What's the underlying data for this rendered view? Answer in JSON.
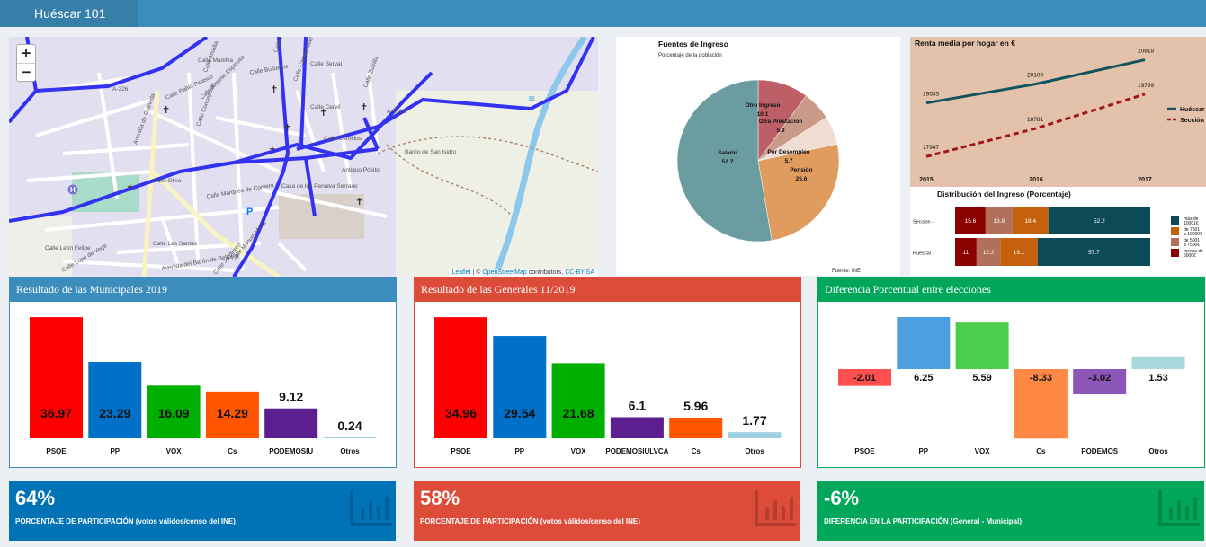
{
  "header": {
    "title": "Huéscar 101"
  },
  "map": {
    "zoom_in": "+",
    "zoom_out": "−",
    "attribution": {
      "leaflet": "Leaflet",
      "sep": " | © ",
      "osm": "OpenStreetMap",
      "contrib": " contributors, ",
      "license": "CC-BY-SA"
    },
    "road_labels": [
      "Calle Manilva",
      "Calle Bulluelos",
      "Calle Serval",
      "Calle Mayor",
      "Calle Pablo Picasso",
      "Calle Antonio Espinosa",
      "Calle Ahadia",
      "Calle Cervil",
      "Calle Campanillas",
      "Calle Zorrilla",
      "A-4302",
      "A-326",
      "Avenida de Granada",
      "Calle Concepción",
      "Calle Cerbillos",
      "Barrio de San Isidro",
      "Antiguo Pósito",
      "Casa de los Penalva Serrano",
      "Calle Oliva",
      "Calle Marqués de Corvera",
      "Calle Las Santas",
      "Calle León Felipe",
      "Calle Lope de Vega",
      "Avenida del Barón de Bellpuig",
      "Calle Manuel Mena",
      "Calle Jardinero"
    ],
    "colors": {
      "roads_main": "#3232f0",
      "river": "#8cc8ec",
      "land": "#e2dff0"
    }
  },
  "pie": {
    "title": "Fuentes de Ingreso",
    "subtitle": "Porcentaje de la población",
    "source": "Fuente: INE",
    "slices": [
      {
        "label": "Otro Ingreso",
        "value": 10.1,
        "color": "#bd5f66"
      },
      {
        "label": "Otra Prestación",
        "value": 5.9,
        "color": "#ca9a88"
      },
      {
        "label": "Por Desempleo",
        "value": 5.7,
        "color": "#efddd2"
      },
      {
        "label": "Pensión",
        "value": 25.6,
        "color": "#e09b5f"
      },
      {
        "label": "Salario",
        "value": 52.7,
        "color": "#6b9ca0"
      }
    ]
  },
  "renta": {
    "title": "Renta media por hogar en €",
    "years": [
      "2015",
      "2016",
      "2017"
    ],
    "series": [
      {
        "name": "Huéscar",
        "values": [
          19535,
          20100,
          20818
        ],
        "color": "#11535e"
      },
      {
        "name": "Sección",
        "values": [
          17947,
          18781,
          19799
        ],
        "color": "#a01515"
      }
    ]
  },
  "distribucion": {
    "title": "Distribución del Ingreso (Porcentaje)",
    "rows": [
      {
        "label": "Seccion",
        "values": [
          15.6,
          13.8,
          18.4,
          52.2
        ]
      },
      {
        "label": "Huescar",
        "values": [
          11,
          12.2,
          19.1,
          57.7
        ]
      }
    ],
    "segment_colors": [
      "#8b0000",
      "#b0705a",
      "#c5600d",
      "#0c4a58"
    ],
    "legend": [
      {
        "lines": [
          "más de",
          "10001€"
        ],
        "color": "#0c4a58"
      },
      {
        "lines": [
          "de 7501",
          "a 10000€"
        ],
        "color": "#c5600d"
      },
      {
        "lines": [
          "de 5001",
          "a 7500€"
        ],
        "color": "#b0705a"
      },
      {
        "lines": [
          "menos de",
          "5000€"
        ],
        "color": "#8b0000"
      }
    ]
  },
  "municipales": {
    "title": "Resultado de las Municipales 2019",
    "chart_data": {
      "type": "bar",
      "categories": [
        "PSOE",
        "PP",
        "VOX",
        "Cs",
        "PODEMOSIU",
        "Otros"
      ],
      "values": [
        36.97,
        23.29,
        16.09,
        14.29,
        9.12,
        0.24
      ],
      "labels": [
        "36.97",
        "23.29",
        "16.09",
        "14.29",
        "9.12",
        "0.24"
      ],
      "colors": [
        "#ff0000",
        "#0070c8",
        "#00b000",
        "#ff5500",
        "#5b1f8f",
        "#9dd0e0"
      ],
      "ylim": [
        0,
        37
      ]
    }
  },
  "generales": {
    "title": "Resultado de las Generales 11/2019",
    "chart_data": {
      "type": "bar",
      "categories": [
        "PSOE",
        "PP",
        "VOX",
        "PODEMOSIULVCA",
        "Cs",
        "Otros"
      ],
      "values": [
        34.96,
        29.54,
        21.68,
        6.1,
        5.96,
        1.77
      ],
      "labels": [
        "34.96",
        "29.54",
        "21.68",
        "6.1",
        "5.96",
        "1.77"
      ],
      "colors": [
        "#ff0000",
        "#0070c8",
        "#00b000",
        "#5b1f8f",
        "#ff5500",
        "#9dd0e0"
      ],
      "ylim": [
        0,
        35
      ]
    }
  },
  "diferencia": {
    "title": "Diferencia Porcentual entre elecciones",
    "chart_data": {
      "type": "bar",
      "categories": [
        "PSOE",
        "PP",
        "VOX",
        "Cs",
        "PODEMOS",
        "Otros"
      ],
      "values": [
        -2.01,
        6.25,
        5.59,
        -8.33,
        -3.02,
        1.53
      ],
      "labels": [
        "-2.01",
        "6.25",
        "5.59",
        "-8.33",
        "-3.02",
        "1.53"
      ],
      "colors": [
        "#ff4f4f",
        "#4d9fdf",
        "#4dcf4d",
        "#ff8844",
        "#8c55b8",
        "#a8d8dc"
      ],
      "ylim": [
        -8.33,
        6.25
      ]
    }
  },
  "participacion_municipal": {
    "value": "64%",
    "label": "PORCENTAJE DE PARTICIPACIÓN (votos válidos/censo del INE)"
  },
  "participacion_general": {
    "value": "58%",
    "label": "PORCENTAJE DE PARTICIPACIÓN (votos válidos/censo del INE)"
  },
  "diferencia_participacion": {
    "value": "-6%",
    "label": "DIFERENCIA EN LA PARTICIPACIÓN (General - Municipal)"
  }
}
